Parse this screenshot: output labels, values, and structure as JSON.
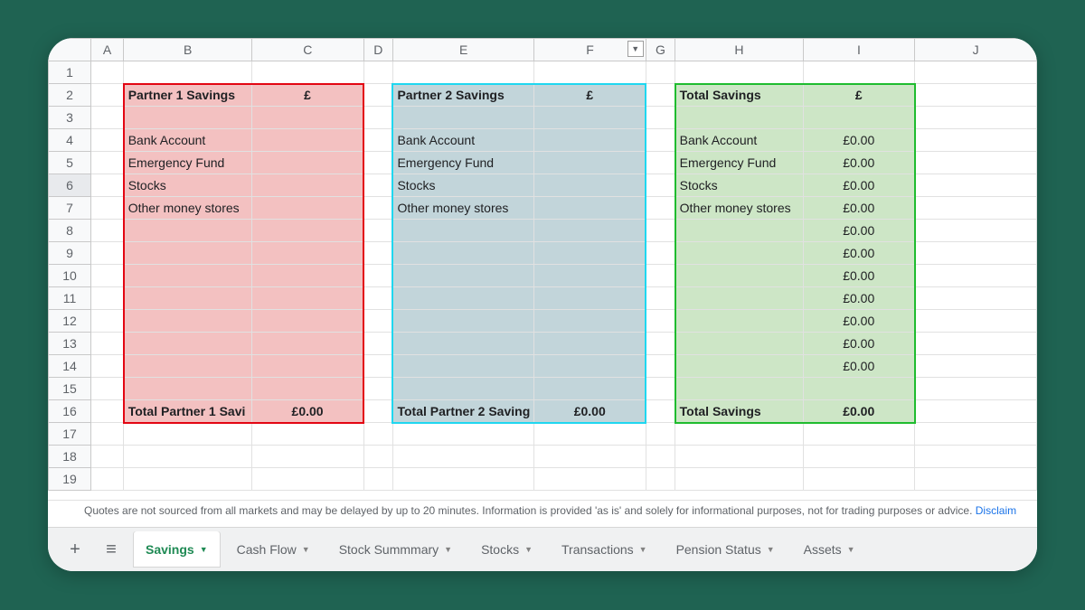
{
  "columns": [
    "A",
    "B",
    "C",
    "D",
    "E",
    "F",
    "G",
    "H",
    "I",
    "J"
  ],
  "rows": 19,
  "selectedRow": 6,
  "partner1": {
    "title": "Partner 1 Savings",
    "currency": "£",
    "items": {
      "r4": "Bank Account",
      "r5": "Emergency Fund",
      "r6": "Stocks",
      "r7": "Other money stores"
    },
    "totalLabel": "Total Partner 1 Savi",
    "totalValue": "£0.00"
  },
  "partner2": {
    "title": "Partner 2 Savings",
    "currency": "£",
    "items": {
      "r4": "Bank Account",
      "r5": "Emergency Fund",
      "r6": "Stocks",
      "r7": "Other money stores"
    },
    "totalLabel": "Total Partner 2 Saving",
    "totalValue": "£0.00"
  },
  "total": {
    "title": "Total Savings",
    "currency": "£",
    "items": {
      "r4": "Bank Account",
      "r5": "Emergency Fund",
      "r6": "Stocks",
      "r7": "Other money stores"
    },
    "values": {
      "r4": "£0.00",
      "r5": "£0.00",
      "r6": "£0.00",
      "r7": "£0.00",
      "r8": "£0.00",
      "r9": "£0.00",
      "r10": "£0.00",
      "r11": "£0.00",
      "r12": "£0.00",
      "r13": "£0.00",
      "r14": "£0.00"
    },
    "totalLabel": "Total Savings",
    "totalValue": "£0.00"
  },
  "filterIcon": "▼",
  "disclaimer": {
    "text": "Quotes are not sourced from all markets and may be delayed by up to 20 minutes. Information is provided 'as is' and solely for informational purposes, not for trading purposes or advice. ",
    "link": "Disclaim"
  },
  "tabs": [
    {
      "label": "Savings",
      "active": true
    },
    {
      "label": "Cash Flow",
      "active": false
    },
    {
      "label": "Stock Summmary",
      "active": false
    },
    {
      "label": "Stocks",
      "active": false
    },
    {
      "label": "Transactions",
      "active": false
    },
    {
      "label": "Pension Status",
      "active": false
    },
    {
      "label": "Assets",
      "active": false
    }
  ],
  "addIcon": "+",
  "allSheetsIcon": "≡",
  "dropdownIcon": "▼"
}
